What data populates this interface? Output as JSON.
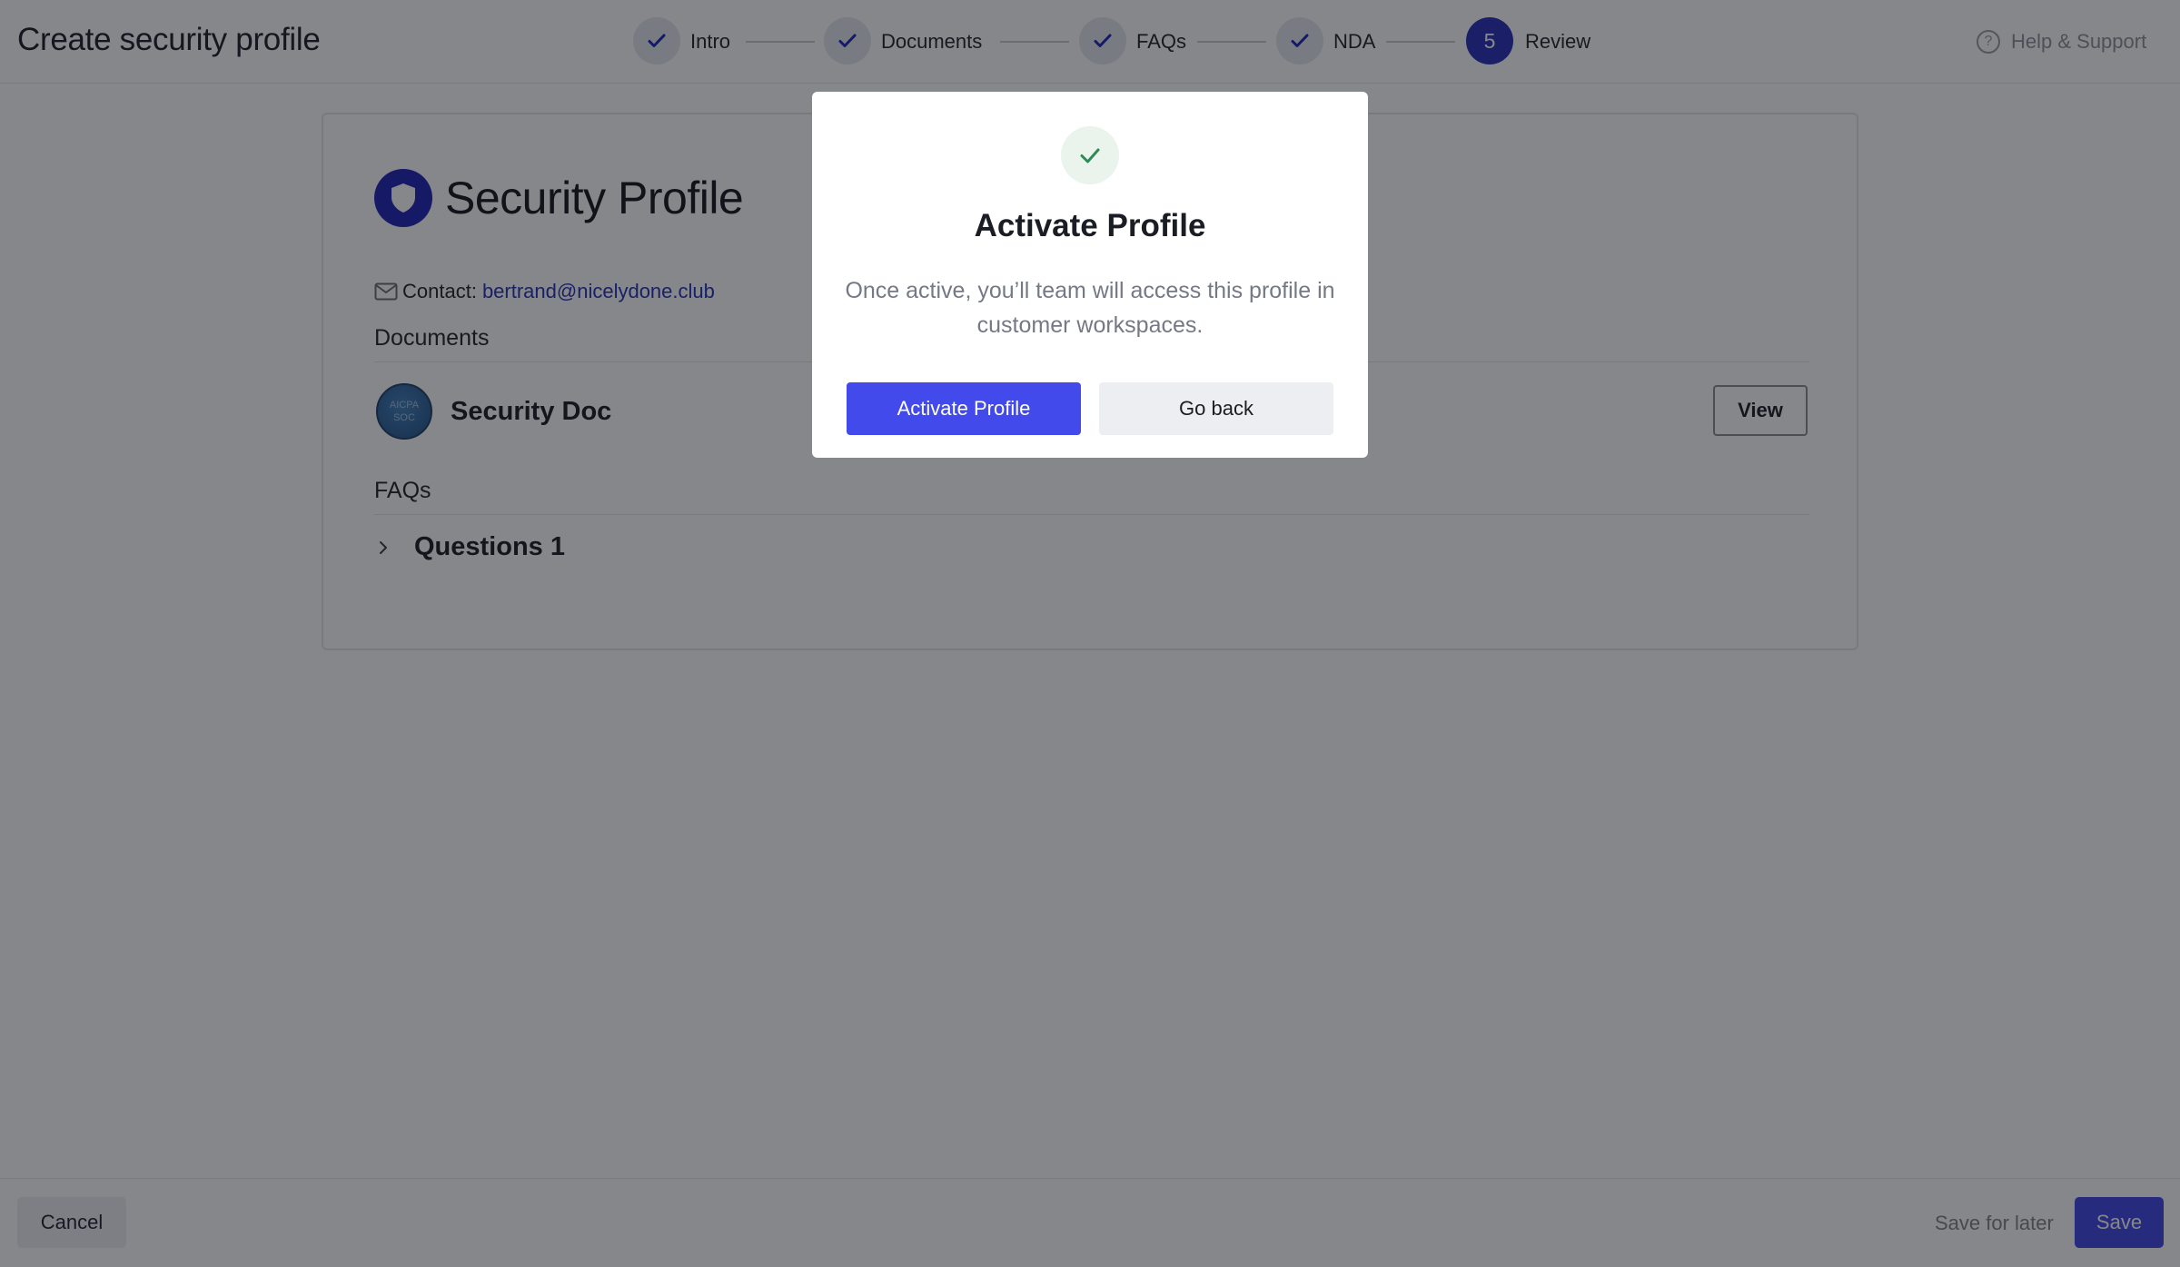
{
  "header": {
    "title": "Create security profile",
    "help_label": "Help & Support",
    "help_icon": "question-circle-icon"
  },
  "stepper": {
    "steps": [
      {
        "label": "Intro",
        "status": "complete",
        "icon": "check-icon"
      },
      {
        "label": "Documents",
        "status": "complete",
        "icon": "check-icon"
      },
      {
        "label": "FAQs",
        "status": "complete",
        "icon": "check-icon"
      },
      {
        "label": "NDA",
        "status": "complete",
        "icon": "check-icon"
      },
      {
        "label": "Review",
        "status": "current",
        "number": "5"
      }
    ]
  },
  "profile": {
    "title": "Security Profile",
    "badge_icon": "shield-icon",
    "contact_label": "Contact:",
    "contact_email": "bertrand@nicelydone.club",
    "documents_label": "Documents",
    "documents": [
      {
        "title": "Security Doc",
        "logo_text": [
          "AICPA",
          "SOC"
        ],
        "action_label": "View"
      }
    ],
    "faqs_label": "FAQs",
    "faqs": [
      {
        "title": "Questions 1"
      }
    ]
  },
  "footer": {
    "cancel_label": "Cancel",
    "save_later_label": "Save for later",
    "save_label": "Save"
  },
  "modal": {
    "title": "Activate Profile",
    "body": "Once active, you’ll team will access this profile in customer workspaces.",
    "primary_label": "Activate Profile",
    "secondary_label": "Go back",
    "icon": "check-icon"
  },
  "colors": {
    "brand_primary": "#434aeb",
    "brand_dark": "#1d23b7",
    "step_active": "#272fb8",
    "success_green": "#2e8b57",
    "link": "#2430b8"
  }
}
